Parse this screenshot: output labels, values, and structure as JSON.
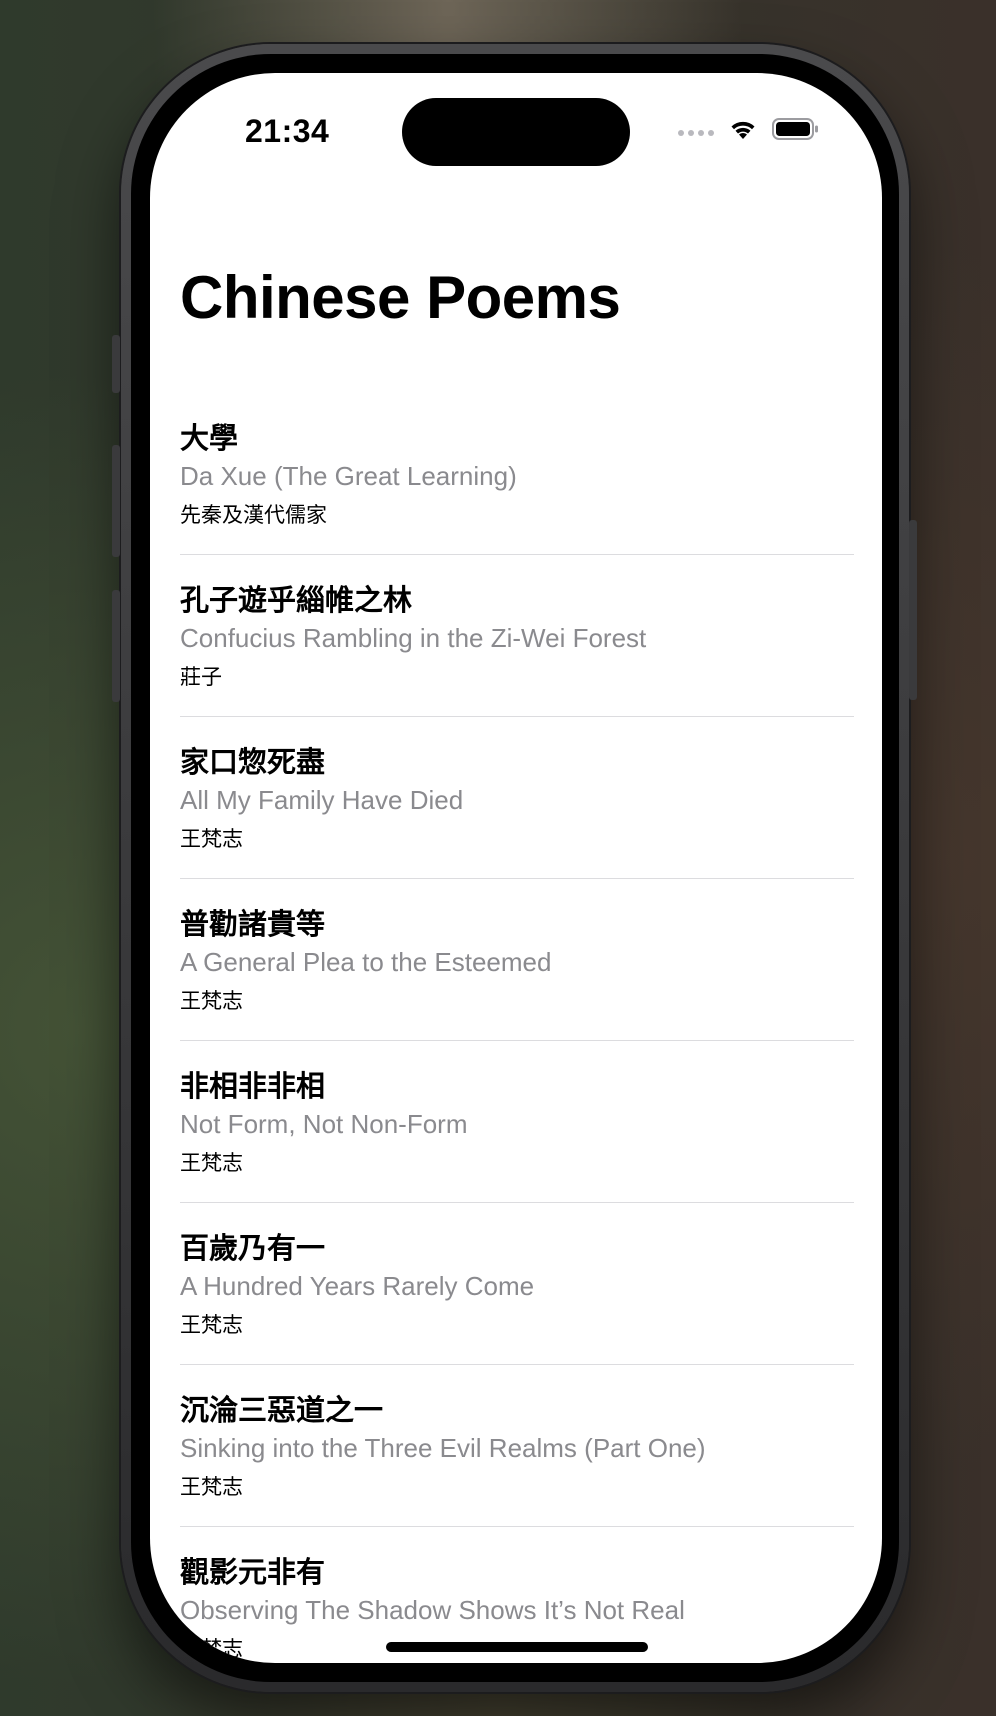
{
  "status_bar": {
    "time": "21:34",
    "icons": [
      "cellular-signal-icon",
      "wifi-icon",
      "battery-icon"
    ]
  },
  "header": {
    "title": "Chinese Poems"
  },
  "poems": [
    {
      "title": "大學",
      "subtitle": "Da Xue (The Great Learning)",
      "author": "先秦及漢代儒家"
    },
    {
      "title": "孔子遊乎緇帷之林",
      "subtitle": "Confucius Rambling in the Zi-Wei Forest",
      "author": "莊子"
    },
    {
      "title": "家口惣死盡",
      "subtitle": "All My Family Have Died",
      "author": "王梵志"
    },
    {
      "title": "普勸諸貴等",
      "subtitle": "A General Plea to the Esteemed",
      "author": "王梵志"
    },
    {
      "title": "非相非非相",
      "subtitle": "Not Form, Not Non-Form",
      "author": "王梵志"
    },
    {
      "title": "百歲乃有一",
      "subtitle": "A Hundred Years Rarely Come",
      "author": "王梵志"
    },
    {
      "title": "沉淪三惡道之一",
      "subtitle": "Sinking into the Three Evil Realms (Part One)",
      "author": "王梵志"
    },
    {
      "title": "觀影元非有",
      "subtitle": "Observing The Shadow Shows It’s Not Real",
      "author": "王梵志"
    }
  ],
  "colors": {
    "background": "#ffffff",
    "title": "#000000",
    "subtitle": "#8a8a8e",
    "separator": "#dcdcdf"
  }
}
